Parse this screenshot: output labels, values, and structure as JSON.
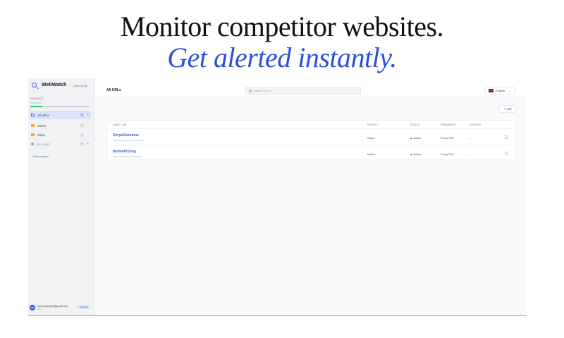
{
  "hero": {
    "line1": "Monitor competitor websites.",
    "line2": "Get alerted instantly."
  },
  "app": {
    "brand": "WebWatch",
    "dark_mode_label": "Dark mode",
    "product_label": "PRODUCT",
    "usage_text": "2/10 URLs",
    "usage_fraction": 0.2,
    "nav": [
      {
        "label": "All URLs",
        "count": "2",
        "icon": "grid-icon",
        "active": true
      },
      {
        "label": "Notion",
        "count": "1",
        "icon": "folder-icon",
        "active": false
      },
      {
        "label": "Stripe",
        "count": "1",
        "icon": "folder-icon",
        "active": false
      },
      {
        "label": "No project",
        "count": "0",
        "icon": "no-project-icon",
        "active": false
      }
    ],
    "new_project_label": "+ New project",
    "user": {
      "initials": "RO",
      "email": "romeroproj01@gmail.com",
      "plan": "Basic",
      "badge": "Upgrade"
    },
    "topbar": {
      "title": "All URLs",
      "search_placeholder": "Search URLs...",
      "language": "English"
    },
    "add_label": "+ Add",
    "table": {
      "headers": [
        "NAME / URL",
        "PROJECT",
        "STATUS",
        "FREQUENCY",
        "CHANGES"
      ],
      "rows": [
        {
          "name": "StripeSolutions",
          "url": "https://stripe.com/en-fr/enterprise",
          "project": "Stripe",
          "status": "Active",
          "frequency": "Every 24h",
          "changes": "—"
        },
        {
          "name": "NotionPricing",
          "url": "https://www.notion.com/pricing",
          "project": "Notion",
          "status": "Active",
          "frequency": "Every 24h",
          "changes": "—"
        }
      ]
    },
    "colors": {
      "accent": "#3b5bdb",
      "hero_blue": "#2f4fd8",
      "active_status": "#22c55e",
      "folder": "#f0a030"
    }
  }
}
